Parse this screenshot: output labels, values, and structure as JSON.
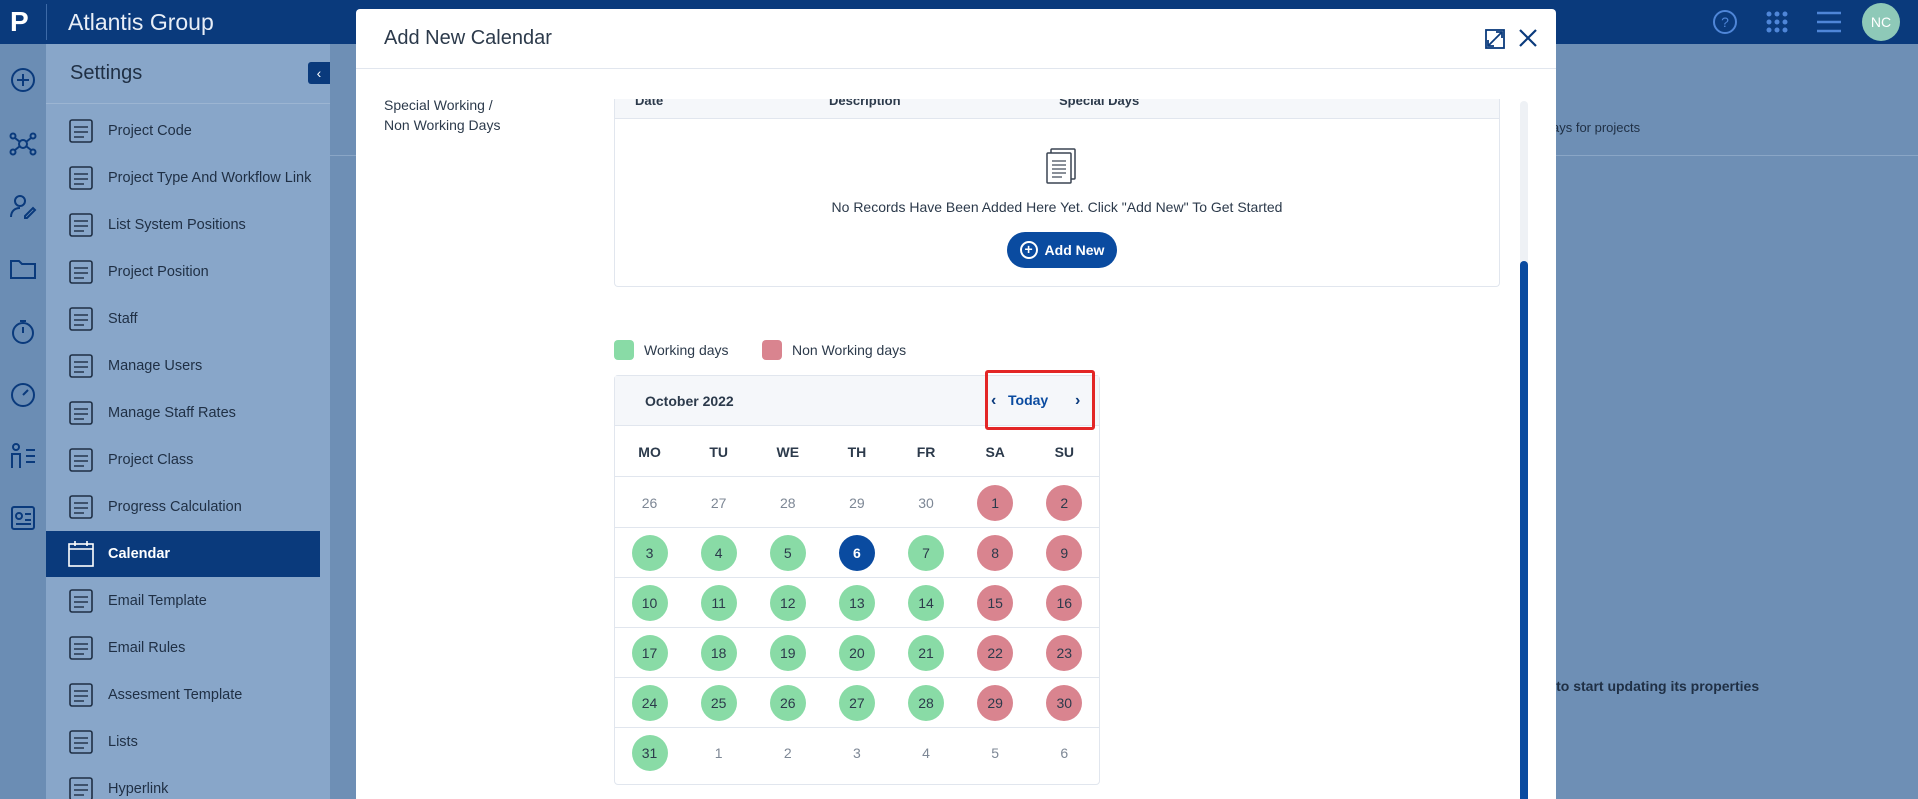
{
  "app": {
    "logo": "P",
    "title": "Atlantis Group",
    "user_initials": "NC"
  },
  "topbar_icons": [
    "help-icon",
    "apps-grid-icon",
    "hamburger-menu-icon"
  ],
  "rail_icons": [
    "add-icon",
    "network-icon",
    "user-edit-icon",
    "folder-icon",
    "timer-icon",
    "dashboard-icon",
    "people-chart-icon",
    "report-icon"
  ],
  "settings": {
    "title": "Settings",
    "items": [
      {
        "label": "Project Code",
        "icon": "code-card-icon"
      },
      {
        "label": "Project Type And Workflow Link",
        "icon": "workflow-icon"
      },
      {
        "label": "List System Positions",
        "icon": "monitor-user-icon"
      },
      {
        "label": "Project Position",
        "icon": "org-chart-icon"
      },
      {
        "label": "Staff",
        "icon": "staff-hierarchy-icon"
      },
      {
        "label": "Manage Users",
        "icon": "user-gear-icon"
      },
      {
        "label": "Manage Staff Rates",
        "icon": "clock-dollar-icon"
      },
      {
        "label": "Project Class",
        "icon": "presentation-icon"
      },
      {
        "label": "Progress Calculation",
        "icon": "bar-growth-icon"
      },
      {
        "label": "Calendar",
        "icon": "calendar-icon",
        "active": true
      },
      {
        "label": "Email Template",
        "icon": "email-template-icon"
      },
      {
        "label": "Email Rules",
        "icon": "email-rules-icon"
      },
      {
        "label": "Assesment Template",
        "icon": "assessment-icon"
      },
      {
        "label": "Lists",
        "icon": "list-icon"
      },
      {
        "label": "Hyperlink",
        "icon": "globe-icon"
      }
    ]
  },
  "background": {
    "text1": "ays for projects",
    "text2": "nel to start updating its properties"
  },
  "modal": {
    "title": "Add New Calendar",
    "section_label": "Special Working / Non Working Days",
    "table": {
      "columns": [
        "Date",
        "Description",
        "Special Days"
      ],
      "empty_text": "No Records Have Been Added Here Yet. Click \"Add New\" To Get Started",
      "add_new_label": "Add New"
    },
    "legend": {
      "working": "Working days",
      "nonworking": "Non Working days",
      "working_color": "#89dba6",
      "nonworking_color": "#d9848f"
    },
    "calendar": {
      "month": "October 2022",
      "today_label": "Today",
      "weekdays": [
        "MO",
        "TU",
        "WE",
        "TH",
        "FR",
        "SA",
        "SU"
      ],
      "weeks": [
        [
          {
            "d": "26",
            "t": "other"
          },
          {
            "d": "27",
            "t": "other"
          },
          {
            "d": "28",
            "t": "other"
          },
          {
            "d": "29",
            "t": "other"
          },
          {
            "d": "30",
            "t": "other"
          },
          {
            "d": "1",
            "t": "nonwork"
          },
          {
            "d": "2",
            "t": "nonwork"
          }
        ],
        [
          {
            "d": "3",
            "t": "work"
          },
          {
            "d": "4",
            "t": "work"
          },
          {
            "d": "5",
            "t": "work"
          },
          {
            "d": "6",
            "t": "today"
          },
          {
            "d": "7",
            "t": "work"
          },
          {
            "d": "8",
            "t": "nonwork"
          },
          {
            "d": "9",
            "t": "nonwork"
          }
        ],
        [
          {
            "d": "10",
            "t": "work"
          },
          {
            "d": "11",
            "t": "work"
          },
          {
            "d": "12",
            "t": "work"
          },
          {
            "d": "13",
            "t": "work"
          },
          {
            "d": "14",
            "t": "work"
          },
          {
            "d": "15",
            "t": "nonwork"
          },
          {
            "d": "16",
            "t": "nonwork"
          }
        ],
        [
          {
            "d": "17",
            "t": "work"
          },
          {
            "d": "18",
            "t": "work"
          },
          {
            "d": "19",
            "t": "work"
          },
          {
            "d": "20",
            "t": "work"
          },
          {
            "d": "21",
            "t": "work"
          },
          {
            "d": "22",
            "t": "nonwork"
          },
          {
            "d": "23",
            "t": "nonwork"
          }
        ],
        [
          {
            "d": "24",
            "t": "work"
          },
          {
            "d": "25",
            "t": "work"
          },
          {
            "d": "26",
            "t": "work"
          },
          {
            "d": "27",
            "t": "work"
          },
          {
            "d": "28",
            "t": "work"
          },
          {
            "d": "29",
            "t": "nonwork"
          },
          {
            "d": "30",
            "t": "nonwork"
          }
        ],
        [
          {
            "d": "31",
            "t": "work"
          },
          {
            "d": "1",
            "t": "other"
          },
          {
            "d": "2",
            "t": "other"
          },
          {
            "d": "3",
            "t": "other"
          },
          {
            "d": "4",
            "t": "other"
          },
          {
            "d": "5",
            "t": "other"
          },
          {
            "d": "6",
            "t": "other"
          }
        ]
      ]
    }
  }
}
